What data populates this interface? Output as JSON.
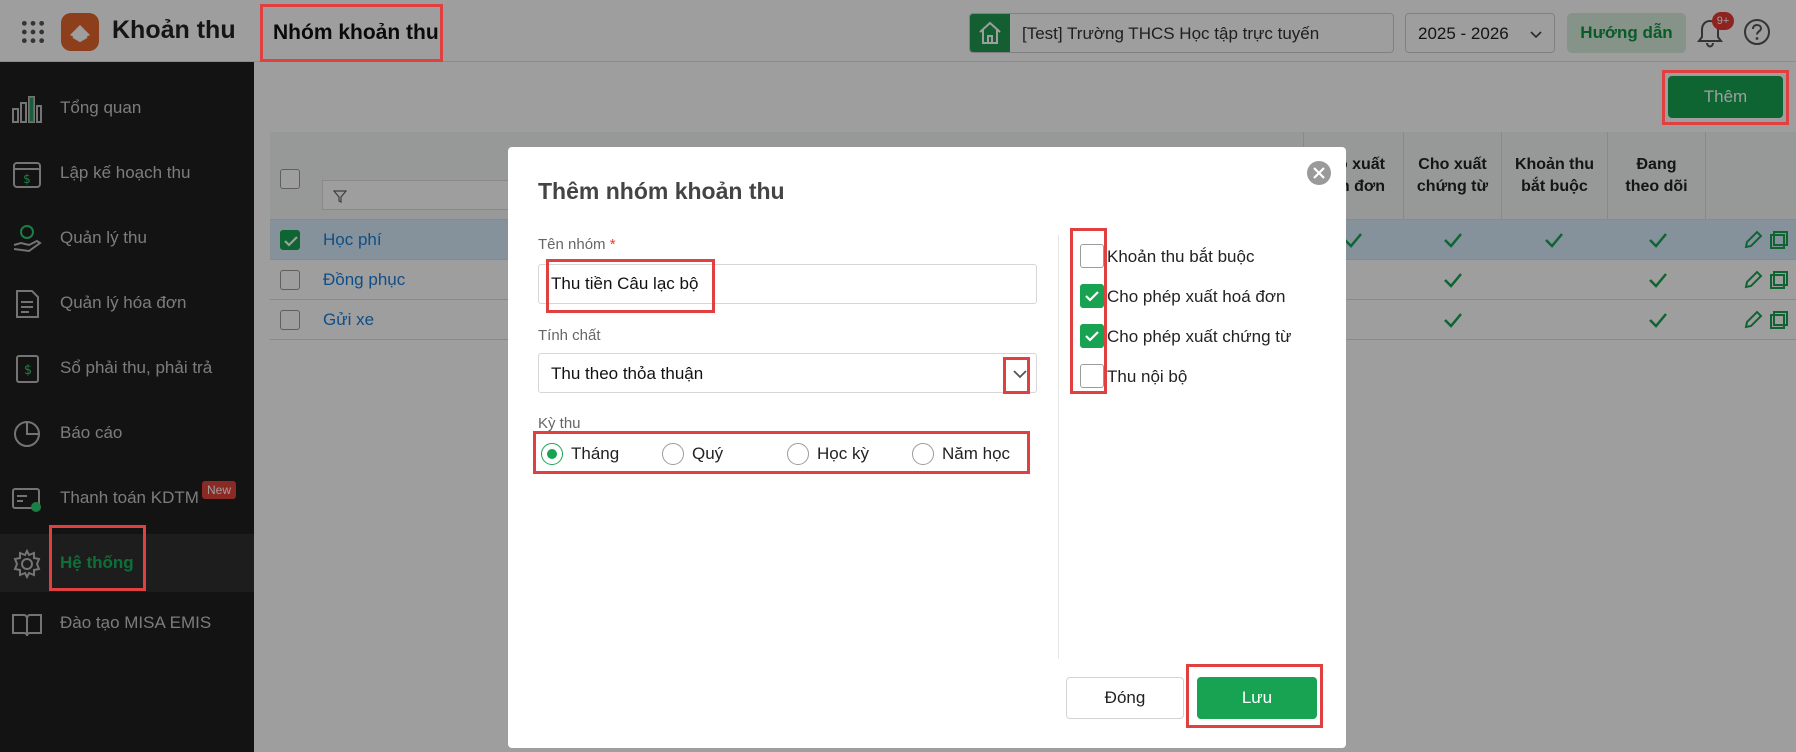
{
  "header": {
    "app_title": "Khoản thu",
    "page_title": "Nhóm khoản thu",
    "school": "[Test] Trường THCS Học tập trực tuyến",
    "year": "2025 - 2026",
    "guide_label": "Hướng dẫn",
    "notification_badge": "9+"
  },
  "sidebar": {
    "items": [
      {
        "label": "Tổng quan",
        "icon": "bar-chart-icon"
      },
      {
        "label": "Lập kế hoạch thu",
        "icon": "calendar-dollar-icon"
      },
      {
        "label": "Quản lý thu",
        "icon": "hand-coin-icon"
      },
      {
        "label": "Quản lý hóa đơn",
        "icon": "invoice-icon"
      },
      {
        "label": "Sổ phải thu, phải trả",
        "icon": "ledger-icon"
      },
      {
        "label": "Báo cáo",
        "icon": "pie-chart-icon"
      },
      {
        "label": "Thanh toán KDTM",
        "icon": "payment-card-icon",
        "badge": "New"
      },
      {
        "label": "Hệ thống",
        "icon": "gear-icon",
        "active": true
      },
      {
        "label": "Đào tạo MISA EMIS",
        "icon": "book-icon"
      }
    ]
  },
  "toolbar": {
    "add_label": "Thêm"
  },
  "table": {
    "headers": [
      "o xuất\nn đơn",
      "Cho xuất\nchứng từ",
      "Khoản thu\nbắt buộc",
      "Đang\ntheo dõi"
    ],
    "rows": [
      {
        "name": "Học phí",
        "selected": true
      },
      {
        "name": "Đồng phục",
        "selected": false
      },
      {
        "name": "Gửi xe",
        "selected": false
      }
    ]
  },
  "modal": {
    "title": "Thêm nhóm khoản thu",
    "name_label": "Tên nhóm",
    "required_mark": "*",
    "name_value": "Thu tiền Câu lạc bộ",
    "type_label": "Tính chất",
    "type_value": "Thu theo thỏa thuận",
    "period_label": "Kỳ thu",
    "periods": [
      {
        "label": "Tháng",
        "selected": true
      },
      {
        "label": "Quý",
        "selected": false
      },
      {
        "label": "Học kỳ",
        "selected": false
      },
      {
        "label": "Năm học",
        "selected": false
      }
    ],
    "options": [
      {
        "label": "Khoản thu bắt buộc",
        "checked": false
      },
      {
        "label": "Cho phép xuất hoá đơn",
        "checked": true
      },
      {
        "label": "Cho phép xuất chứng từ",
        "checked": true
      },
      {
        "label": "Thu nội bộ",
        "checked": false
      }
    ],
    "close_label": "Đóng",
    "save_label": "Lưu"
  },
  "colors": {
    "accent": "#18a352",
    "highlight": "#e04040",
    "sidebar_bg": "#1f1f1f"
  }
}
